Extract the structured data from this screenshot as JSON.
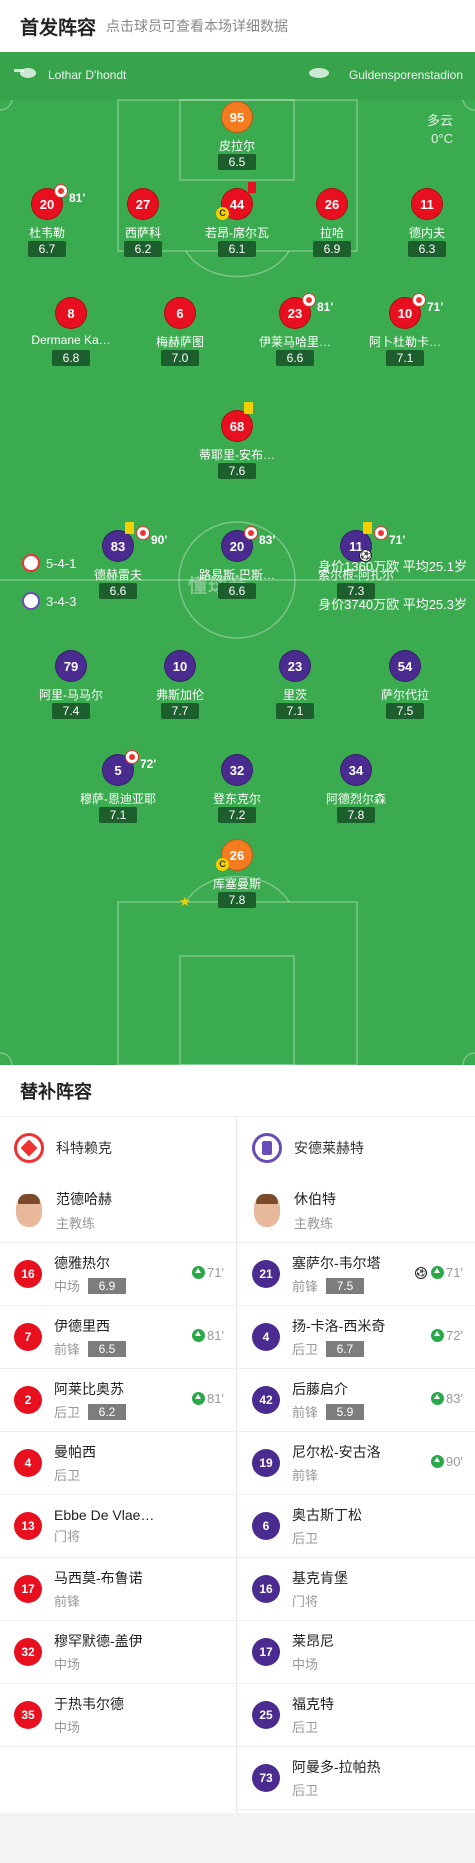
{
  "header": {
    "title": "首发阵容",
    "subtitle": "点击球员可查看本场详细数据"
  },
  "pitch_info": {
    "referee": "Lothar D'hondt",
    "stadium": "Guldensporenstadion",
    "weather": "多云",
    "temperature": "0°C",
    "watermark": "懂球帝"
  },
  "home": {
    "formation": "5-4-1",
    "value": "身价1360万欧 平均25.1岁",
    "players": [
      {
        "num": "95",
        "name": "皮拉尔",
        "rating": "6.5",
        "line": 0,
        "pos": 0
      },
      {
        "num": "20",
        "name": "杜韦勒",
        "rating": "6.7",
        "line": 1,
        "pos": 0,
        "sub": "81'"
      },
      {
        "num": "27",
        "name": "西萨科",
        "rating": "6.2",
        "line": 1,
        "pos": 1
      },
      {
        "num": "44",
        "name": "若昂-席尔瓦",
        "rating": "6.1",
        "line": 1,
        "pos": 2,
        "captain": "C",
        "red": true
      },
      {
        "num": "26",
        "name": "拉哈",
        "rating": "6.9",
        "line": 1,
        "pos": 3
      },
      {
        "num": "11",
        "name": "德内夫",
        "rating": "6.3",
        "line": 1,
        "pos": 4
      },
      {
        "num": "8",
        "name": "Dermane Ka…",
        "rating": "6.8",
        "line": 2,
        "pos": 0
      },
      {
        "num": "6",
        "name": "梅赫萨图",
        "rating": "7.0",
        "line": 2,
        "pos": 1
      },
      {
        "num": "23",
        "name": "伊莱马哈里…",
        "rating": "6.6",
        "line": 2,
        "pos": 2,
        "sub": "81'"
      },
      {
        "num": "10",
        "name": "阿卜杜勒卡…",
        "rating": "7.1",
        "line": 2,
        "pos": 3,
        "sub": "71'"
      },
      {
        "num": "68",
        "name": "蒂耶里-安布…",
        "rating": "7.6",
        "line": 3,
        "pos": 0,
        "yellow": true
      }
    ]
  },
  "away": {
    "formation": "3-4-3",
    "value": "身价3740万欧 平均25.3岁",
    "players": [
      {
        "num": "83",
        "name": "德赫雷夫",
        "rating": "6.6",
        "line": 0,
        "pos": 0,
        "yellow": true,
        "sub": "90'"
      },
      {
        "num": "20",
        "name": "路易斯-巴斯…",
        "rating": "6.6",
        "line": 0,
        "pos": 1,
        "sub": "83'"
      },
      {
        "num": "11",
        "name": "索尔根-阿扎尔",
        "rating": "7.3",
        "line": 0,
        "pos": 2,
        "yellow": true,
        "sub": "71'",
        "goal": true
      },
      {
        "num": "79",
        "name": "阿里-马马尔",
        "rating": "7.4",
        "line": 1,
        "pos": 0
      },
      {
        "num": "10",
        "name": "弗斯加伦",
        "rating": "7.7",
        "line": 1,
        "pos": 1
      },
      {
        "num": "23",
        "name": "里茨",
        "rating": "7.1",
        "line": 1,
        "pos": 2
      },
      {
        "num": "54",
        "name": "萨尔代拉",
        "rating": "7.5",
        "line": 1,
        "pos": 3
      },
      {
        "num": "5",
        "name": "穆萨-恩迪亚耶",
        "rating": "7.1",
        "line": 2,
        "pos": 0,
        "sub": "72'"
      },
      {
        "num": "32",
        "name": "登东克尔",
        "rating": "7.2",
        "line": 2,
        "pos": 1
      },
      {
        "num": "34",
        "name": "阿德烈尔森",
        "rating": "7.8",
        "line": 2,
        "pos": 2
      },
      {
        "num": "26",
        "name": "库塞曼斯",
        "rating": "7.8",
        "line": 3,
        "pos": 0,
        "captain": "C",
        "star": true
      }
    ]
  },
  "subs": {
    "title": "替补阵容",
    "home": {
      "team": "科特赖克",
      "coach": "范德哈赫",
      "coach_role": "主教练",
      "list": [
        {
          "num": "16",
          "name": "德雅热尔",
          "role": "中场",
          "rating": "6.9",
          "in": "71'"
        },
        {
          "num": "7",
          "name": "伊德里西",
          "role": "前锋",
          "rating": "6.5",
          "in": "81'"
        },
        {
          "num": "2",
          "name": "阿莱比奥苏",
          "role": "后卫",
          "rating": "6.2",
          "in": "81'"
        },
        {
          "num": "4",
          "name": "曼帕西",
          "role": "后卫"
        },
        {
          "num": "13",
          "name": "Ebbe De Vlae…",
          "role": "门将"
        },
        {
          "num": "17",
          "name": "马西莫-布鲁诺",
          "role": "前锋"
        },
        {
          "num": "32",
          "name": "穆罕默德-盖伊",
          "role": "中场"
        },
        {
          "num": "35",
          "name": "于热韦尔德",
          "role": "中场"
        }
      ]
    },
    "away": {
      "team": "安德莱赫特",
      "coach": "休伯特",
      "coach_role": "主教练",
      "list": [
        {
          "num": "21",
          "name": "塞萨尔-韦尔塔",
          "role": "前锋",
          "rating": "7.5",
          "in": "71'",
          "goal": true
        },
        {
          "num": "4",
          "name": "扬-卡洛-西米奇",
          "role": "后卫",
          "rating": "6.7",
          "in": "72'"
        },
        {
          "num": "42",
          "name": "后藤启介",
          "role": "前锋",
          "rating": "5.9",
          "in": "83'"
        },
        {
          "num": "19",
          "name": "尼尔松-安古洛",
          "role": "前锋",
          "in": "90'"
        },
        {
          "num": "6",
          "name": "奥古斯丁松",
          "role": "后卫"
        },
        {
          "num": "16",
          "name": "基克肯堡",
          "role": "门将"
        },
        {
          "num": "17",
          "name": "莱昂尼",
          "role": "中场"
        },
        {
          "num": "25",
          "name": "福克特",
          "role": "后卫"
        },
        {
          "num": "73",
          "name": "阿曼多-拉帕热",
          "role": "后卫"
        }
      ]
    }
  }
}
